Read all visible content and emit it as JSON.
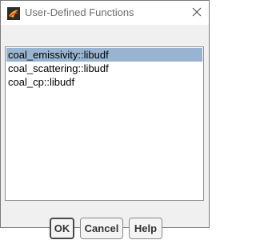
{
  "window": {
    "title": "User-Defined Functions",
    "app_icon": "fluent-app-icon",
    "close_icon": "close-icon"
  },
  "list": {
    "items": [
      {
        "label": "coal_emissivity::libudf",
        "selected": true
      },
      {
        "label": "coal_scattering::libudf",
        "selected": false
      },
      {
        "label": "coal_cp::libudf",
        "selected": false
      }
    ]
  },
  "buttons": {
    "ok_label": "OK",
    "cancel_label": "Cancel",
    "help_label": "Help"
  },
  "colors": {
    "selection": "#99b4d1",
    "client_background": "#f0f0f0",
    "title_text": "#6d6d6d"
  }
}
